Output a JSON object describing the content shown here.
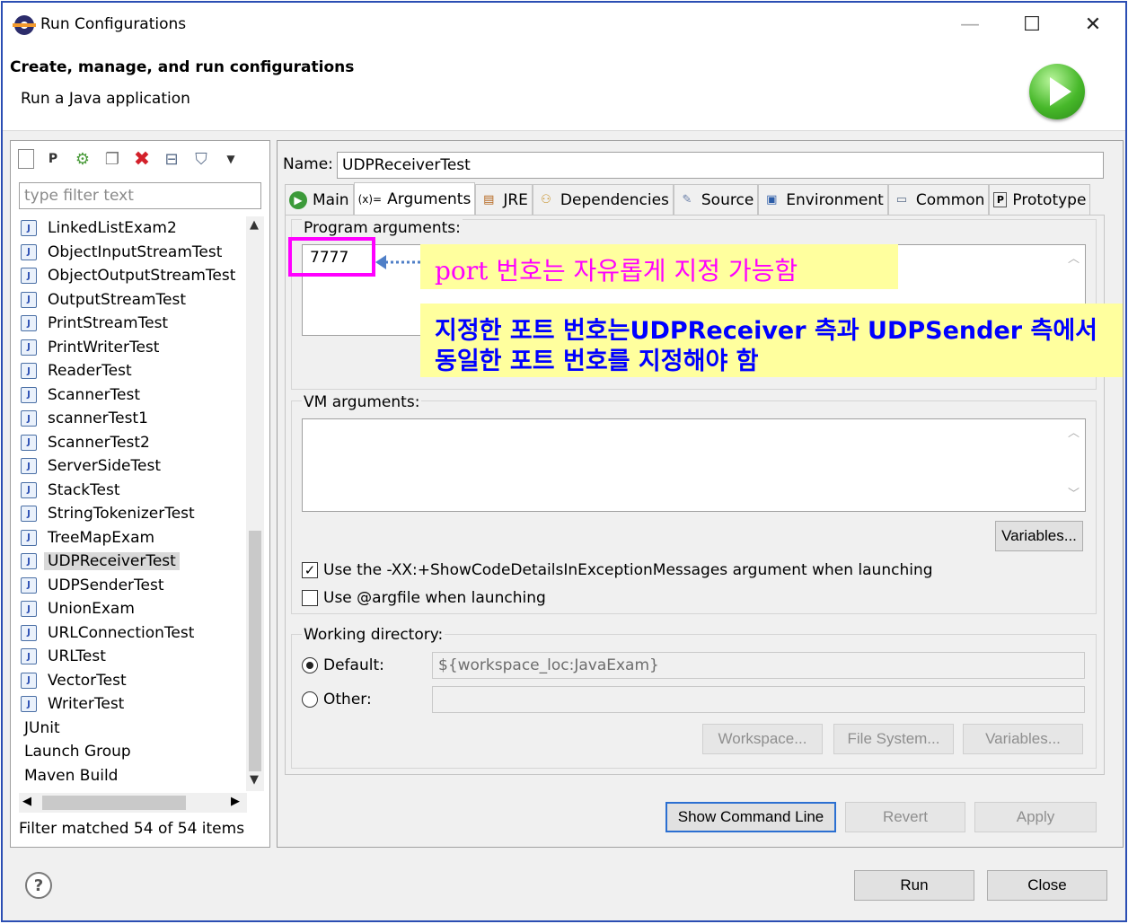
{
  "window": {
    "title": "Run Configurations",
    "minimize_glyph": "—",
    "maximize_glyph": "☐",
    "close_glyph": "✕"
  },
  "header": {
    "title": "Create, manage, and run configurations",
    "subtitle": "Run a Java application",
    "icon": "run-icon"
  },
  "left": {
    "toolbar_icons": [
      "new-configuration-icon",
      "new-prototype-icon",
      "export-icon",
      "duplicate-icon",
      "delete-icon",
      "collapse-all-icon",
      "filter-icon",
      "dropdown-icon"
    ],
    "filter_placeholder": "type filter text",
    "items": [
      {
        "label": "LinkedListExam2",
        "type": "java"
      },
      {
        "label": "ObjectInputStreamTest",
        "type": "java"
      },
      {
        "label": "ObjectOutputStreamTest",
        "type": "java"
      },
      {
        "label": "OutputStreamTest",
        "type": "java"
      },
      {
        "label": "PrintStreamTest",
        "type": "java"
      },
      {
        "label": "PrintWriterTest",
        "type": "java"
      },
      {
        "label": "ReaderTest",
        "type": "java"
      },
      {
        "label": "ScannerTest",
        "type": "java"
      },
      {
        "label": "scannerTest1",
        "type": "java"
      },
      {
        "label": "ScannerTest2",
        "type": "java"
      },
      {
        "label": "ServerSideTest",
        "type": "java"
      },
      {
        "label": "StackTest",
        "type": "java"
      },
      {
        "label": "StringTokenizerTest",
        "type": "java"
      },
      {
        "label": "TreeMapExam",
        "type": "java"
      },
      {
        "label": "UDPReceiverTest",
        "type": "java",
        "selected": true
      },
      {
        "label": "UDPSenderTest",
        "type": "java"
      },
      {
        "label": "UnionExam",
        "type": "java"
      },
      {
        "label": "URLConnectionTest",
        "type": "java"
      },
      {
        "label": "URLTest",
        "type": "java"
      },
      {
        "label": "VectorTest",
        "type": "java"
      },
      {
        "label": "WriterTest",
        "type": "java"
      },
      {
        "label": "JUnit",
        "type": "category"
      },
      {
        "label": "Launch Group",
        "type": "category"
      },
      {
        "label": "Maven Build",
        "type": "category"
      }
    ],
    "filter_status": "Filter matched 54 of 54 items"
  },
  "config": {
    "name_label": "Name:",
    "name_value": "UDPReceiverTest",
    "tabs": [
      {
        "label": "Main",
        "icon": "main-tab-icon"
      },
      {
        "label": "Arguments",
        "icon": "arguments-tab-icon",
        "prefix": "(x)=",
        "active": true
      },
      {
        "label": "JRE",
        "icon": "jre-tab-icon"
      },
      {
        "label": "Dependencies",
        "icon": "dependencies-tab-icon"
      },
      {
        "label": "Source",
        "icon": "source-tab-icon"
      },
      {
        "label": "Environment",
        "icon": "environment-tab-icon"
      },
      {
        "label": "Common",
        "icon": "common-tab-icon"
      },
      {
        "label": "Prototype",
        "icon": "prototype-tab-icon"
      }
    ],
    "program_args_label": "Program arguments:",
    "program_args_value": "7777",
    "vm_args_label": "VM arguments:",
    "vm_args_value": "",
    "variables_button": "Variables...",
    "checkbox_showcode": {
      "label": "Use the -XX:+ShowCodeDetailsInExceptionMessages argument when launching",
      "checked": true
    },
    "checkbox_argfile": {
      "label": "Use @argfile when launching",
      "checked": false
    },
    "working_dir_label": "Working directory:",
    "default_label": "Default:",
    "default_value": "${workspace_loc:JavaExam}",
    "other_label": "Other:",
    "other_value": "",
    "workspace_button": "Workspace...",
    "filesystem_button": "File System...",
    "wd_variables_button": "Variables..."
  },
  "bottom": {
    "show_command_line": "Show Command Line",
    "revert": "Revert",
    "apply": "Apply",
    "run": "Run",
    "close": "Close",
    "help_glyph": "?"
  },
  "annotations": {
    "note1": "port 번호는 자유롭게 지정 가능함",
    "note2_line1": "지정한 포트 번호는UDPReceiver 측과 UDPSender 측에서",
    "note2_line2": "동일한 포트 번호를 지정해야 함"
  },
  "colors": {
    "accent": "#2b4eb3",
    "annotation_bg": "#ffff9e",
    "annotation_pink": "#ff00ff",
    "annotation_blue": "#0000ff"
  }
}
